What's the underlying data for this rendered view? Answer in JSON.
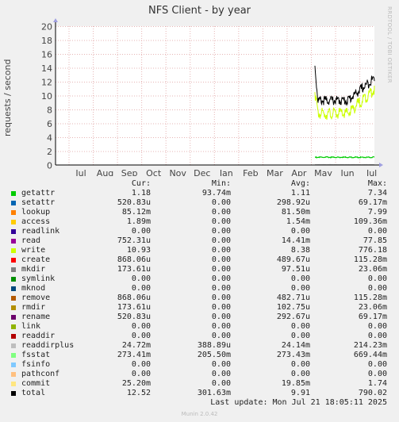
{
  "header": {
    "title": "NFS Client - by year",
    "side_label": "RRDTOOL / TOBI OETIKER"
  },
  "chart_data": {
    "type": "line",
    "ylabel": "requests / second",
    "ylim": [
      0,
      20
    ],
    "yticks": [
      0,
      2,
      4,
      6,
      8,
      10,
      12,
      14,
      16,
      18,
      20
    ],
    "months": [
      "Jul",
      "Aug",
      "Sep",
      "Oct",
      "Nov",
      "Dec",
      "Jan",
      "Feb",
      "Mar",
      "Apr",
      "May",
      "Jun",
      "Jul"
    ],
    "grid": true,
    "series": [
      {
        "name": "total",
        "color": "#000000",
        "start_value": 14.3,
        "plateau": 9.3,
        "end_value": 12.52
      },
      {
        "name": "write",
        "color": "#ccff00",
        "start_value": 10.5,
        "plateau": 7.4,
        "end_value": 10.93
      },
      {
        "name": "getattr",
        "color": "#00cc00",
        "value": 1.11
      },
      {
        "name": "readdirplus",
        "color": "#bbbbbb",
        "value": 0.05
      }
    ]
  },
  "legend": {
    "headers": [
      "Cur:",
      "Min:",
      "Avg:",
      "Max:"
    ],
    "rows": [
      {
        "name": "getattr",
        "color": "#00cc00",
        "cur": "1.18",
        "min": "93.74m",
        "avg": "1.11",
        "max": "7.34"
      },
      {
        "name": "setattr",
        "color": "#0066b3",
        "cur": "520.83u",
        "min": "0.00",
        "avg": "298.92u",
        "max": "69.17m"
      },
      {
        "name": "lookup",
        "color": "#ff8000",
        "cur": "85.12m",
        "min": "0.00",
        "avg": "81.50m",
        "max": "7.99"
      },
      {
        "name": "access",
        "color": "#ffcc00",
        "cur": "1.89m",
        "min": "0.00",
        "avg": "1.54m",
        "max": "109.36m"
      },
      {
        "name": "readlink",
        "color": "#330099",
        "cur": "0.00",
        "min": "0.00",
        "avg": "0.00",
        "max": "0.00"
      },
      {
        "name": "read",
        "color": "#990099",
        "cur": "752.31u",
        "min": "0.00",
        "avg": "14.41m",
        "max": "77.85"
      },
      {
        "name": "write",
        "color": "#ccff00",
        "cur": "10.93",
        "min": "0.00",
        "avg": "8.38",
        "max": "776.18"
      },
      {
        "name": "create",
        "color": "#ff0000",
        "cur": "868.06u",
        "min": "0.00",
        "avg": "489.67u",
        "max": "115.28m"
      },
      {
        "name": "mkdir",
        "color": "#808080",
        "cur": "173.61u",
        "min": "0.00",
        "avg": "97.51u",
        "max": "23.06m"
      },
      {
        "name": "symlink",
        "color": "#008f00",
        "cur": "0.00",
        "min": "0.00",
        "avg": "0.00",
        "max": "0.00"
      },
      {
        "name": "mknod",
        "color": "#00487d",
        "cur": "0.00",
        "min": "0.00",
        "avg": "0.00",
        "max": "0.00"
      },
      {
        "name": "remove",
        "color": "#b35a00",
        "cur": "868.06u",
        "min": "0.00",
        "avg": "482.71u",
        "max": "115.28m"
      },
      {
        "name": "rmdir",
        "color": "#b38f00",
        "cur": "173.61u",
        "min": "0.00",
        "avg": "102.75u",
        "max": "23.06m"
      },
      {
        "name": "rename",
        "color": "#6b006b",
        "cur": "520.83u",
        "min": "0.00",
        "avg": "292.67u",
        "max": "69.17m"
      },
      {
        "name": "link",
        "color": "#8fb300",
        "cur": "0.00",
        "min": "0.00",
        "avg": "0.00",
        "max": "0.00"
      },
      {
        "name": "readdir",
        "color": "#b30000",
        "cur": "0.00",
        "min": "0.00",
        "avg": "0.00",
        "max": "0.00"
      },
      {
        "name": "readdirplus",
        "color": "#bebebe",
        "cur": "24.72m",
        "min": "388.89u",
        "avg": "24.14m",
        "max": "214.23m"
      },
      {
        "name": "fsstat",
        "color": "#80ff80",
        "cur": "273.41m",
        "min": "205.50m",
        "avg": "273.43m",
        "max": "669.44m"
      },
      {
        "name": "fsinfo",
        "color": "#80c9ff",
        "cur": "0.00",
        "min": "0.00",
        "avg": "0.00",
        "max": "0.00"
      },
      {
        "name": "pathconf",
        "color": "#ffc080",
        "cur": "0.00",
        "min": "0.00",
        "avg": "0.00",
        "max": "0.00"
      },
      {
        "name": "commit",
        "color": "#ffe680",
        "cur": "25.20m",
        "min": "0.00",
        "avg": "19.85m",
        "max": "1.74"
      },
      {
        "name": "total",
        "color": "#000000",
        "cur": "12.52",
        "min": "301.63m",
        "avg": "9.91",
        "max": "790.02"
      }
    ]
  },
  "footer": {
    "last_update": "Last update: Mon Jul 21 18:05:11 2025",
    "version": "Munin 2.0.42"
  }
}
